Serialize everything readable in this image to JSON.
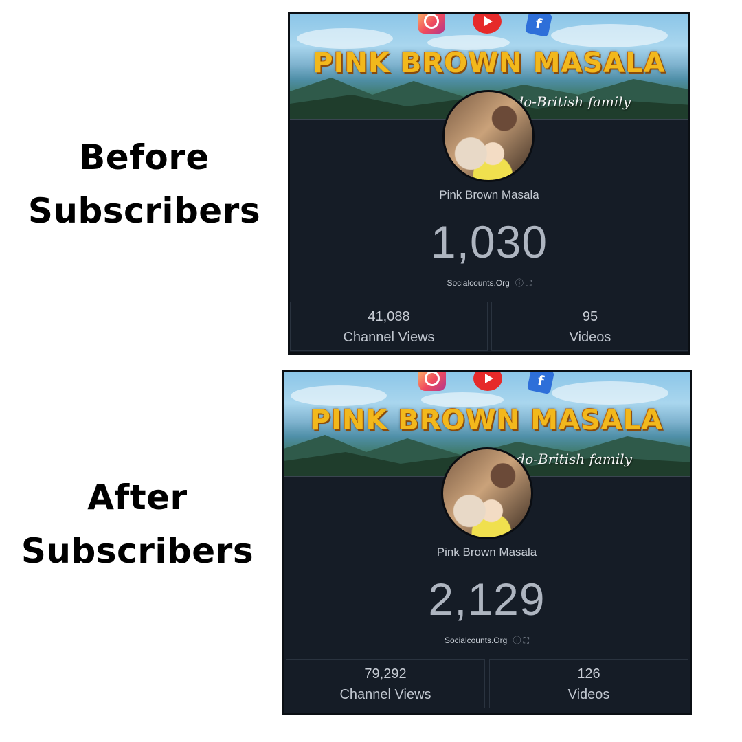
{
  "labels": {
    "before_line1": "Before",
    "before_line2": "Subscribers",
    "after_line1": "After",
    "after_line2": "Subscribers"
  },
  "cards": [
    {
      "banner_title": "PINK BROWN MASALA",
      "banner_tagline": "ndo-British family",
      "social_icons": [
        "instagram-icon",
        "youtube-icon",
        "facebook-icon"
      ],
      "channel_name": "Pink Brown Masala",
      "subscriber_count": "1,030",
      "source": "Socialcounts.Org",
      "source_icons": "ⓘ ⛶",
      "stats": [
        {
          "value": "41,088",
          "label": "Channel Views"
        },
        {
          "value": "95",
          "label": "Videos"
        }
      ]
    },
    {
      "banner_title": "PINK BROWN MASALA",
      "banner_tagline": "ndo-British family",
      "social_icons": [
        "instagram-icon",
        "youtube-icon",
        "facebook-icon"
      ],
      "channel_name": "Pink Brown Masala",
      "subscriber_count": "2,129",
      "source": "Socialcounts.Org",
      "source_icons": "ⓘ ⛶",
      "stats": [
        {
          "value": "79,292",
          "label": "Channel Views"
        },
        {
          "value": "126",
          "label": "Videos"
        }
      ]
    }
  ]
}
